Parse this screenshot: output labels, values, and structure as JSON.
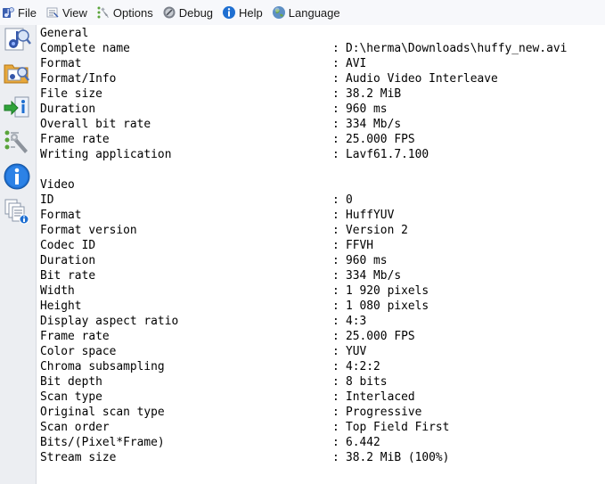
{
  "menu": {
    "items": [
      {
        "name": "menu-file",
        "icon": "file-icon",
        "label": "File"
      },
      {
        "name": "menu-view",
        "icon": "view-icon",
        "label": "View"
      },
      {
        "name": "menu-options",
        "icon": "options-icon",
        "label": "Options"
      },
      {
        "name": "menu-debug",
        "icon": "debug-icon",
        "label": "Debug"
      },
      {
        "name": "menu-help",
        "icon": "help-icon",
        "label": "Help"
      },
      {
        "name": "menu-language",
        "icon": "language-icon",
        "label": "Language"
      }
    ]
  },
  "sidebar": {
    "buttons": [
      "open-file-icon",
      "open-folder-icon",
      "export-icon",
      "preferences-icon",
      "about-icon",
      "multiple-files-icon"
    ]
  },
  "report": {
    "separator": ":",
    "general": {
      "title": "General",
      "rows": [
        {
          "key": "Complete name",
          "value": "D:\\herma\\Downloads\\huffy_new.avi"
        },
        {
          "key": "Format",
          "value": "AVI"
        },
        {
          "key": "Format/Info",
          "value": "Audio Video Interleave"
        },
        {
          "key": "File size",
          "value": "38.2 MiB"
        },
        {
          "key": "Duration",
          "value": "960 ms"
        },
        {
          "key": "Overall bit rate",
          "value": "334 Mb/s"
        },
        {
          "key": "Frame rate",
          "value": "25.000 FPS"
        },
        {
          "key": "Writing application",
          "value": "Lavf61.7.100"
        }
      ]
    },
    "video": {
      "title": "Video",
      "rows": [
        {
          "key": "ID",
          "value": "0"
        },
        {
          "key": "Format",
          "value": "HuffYUV"
        },
        {
          "key": "Format version",
          "value": "Version 2"
        },
        {
          "key": "Codec ID",
          "value": "FFVH"
        },
        {
          "key": "Duration",
          "value": "960 ms"
        },
        {
          "key": "Bit rate",
          "value": "334 Mb/s"
        },
        {
          "key": "Width",
          "value": "1 920 pixels"
        },
        {
          "key": "Height",
          "value": "1 080 pixels"
        },
        {
          "key": "Display aspect ratio",
          "value": "4:3"
        },
        {
          "key": "Frame rate",
          "value": "25.000 FPS"
        },
        {
          "key": "Color space",
          "value": "YUV"
        },
        {
          "key": "Chroma subsampling",
          "value": "4:2:2"
        },
        {
          "key": "Bit depth",
          "value": "8 bits"
        },
        {
          "key": "Scan type",
          "value": "Interlaced"
        },
        {
          "key": "Original scan type",
          "value": "Progressive"
        },
        {
          "key": "Scan order",
          "value": "Top Field First"
        },
        {
          "key": "Bits/(Pixel*Frame)",
          "value": "6.442"
        },
        {
          "key": "Stream size",
          "value": "38.2 MiB (100%)"
        }
      ]
    }
  }
}
